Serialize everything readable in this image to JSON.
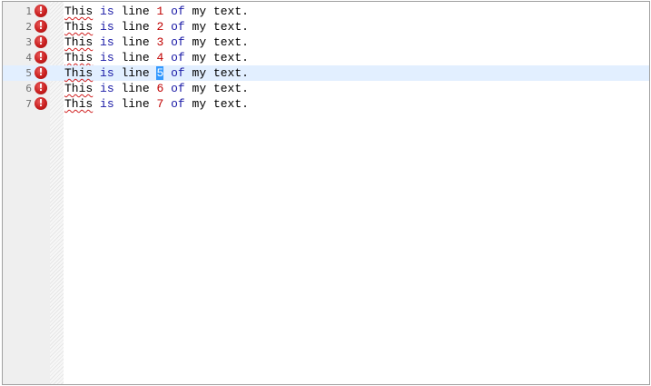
{
  "editor": {
    "error_icon_glyph": "!",
    "error_color": "#c81e1e",
    "current_line_color": "#e2efff",
    "selection_color": "#3399ff",
    "lines": [
      {
        "number": "1",
        "w1": "This",
        "w2": "is",
        "w3": "line",
        "num": "1",
        "w5": "of",
        "w6": "my",
        "w7": "text."
      },
      {
        "number": "2",
        "w1": "This",
        "w2": "is",
        "w3": "line",
        "num": "2",
        "w5": "of",
        "w6": "my",
        "w7": "text."
      },
      {
        "number": "3",
        "w1": "This",
        "w2": "is",
        "w3": "line",
        "num": "3",
        "w5": "of",
        "w6": "my",
        "w7": "text."
      },
      {
        "number": "4",
        "w1": "This",
        "w2": "is",
        "w3": "line",
        "num": "4",
        "w5": "of",
        "w6": "my",
        "w7": "text."
      },
      {
        "number": "5",
        "w1": "This",
        "w2": "is",
        "w3": "line",
        "num": "5",
        "w5": "of",
        "w6": "my",
        "w7": "text."
      },
      {
        "number": "6",
        "w1": "This",
        "w2": "is",
        "w3": "line",
        "num": "6",
        "w5": "of",
        "w6": "my",
        "w7": "text."
      },
      {
        "number": "7",
        "w1": "This",
        "w2": "is",
        "w3": "line",
        "num": "7",
        "w5": "of",
        "w6": "my",
        "w7": "text."
      }
    ]
  }
}
